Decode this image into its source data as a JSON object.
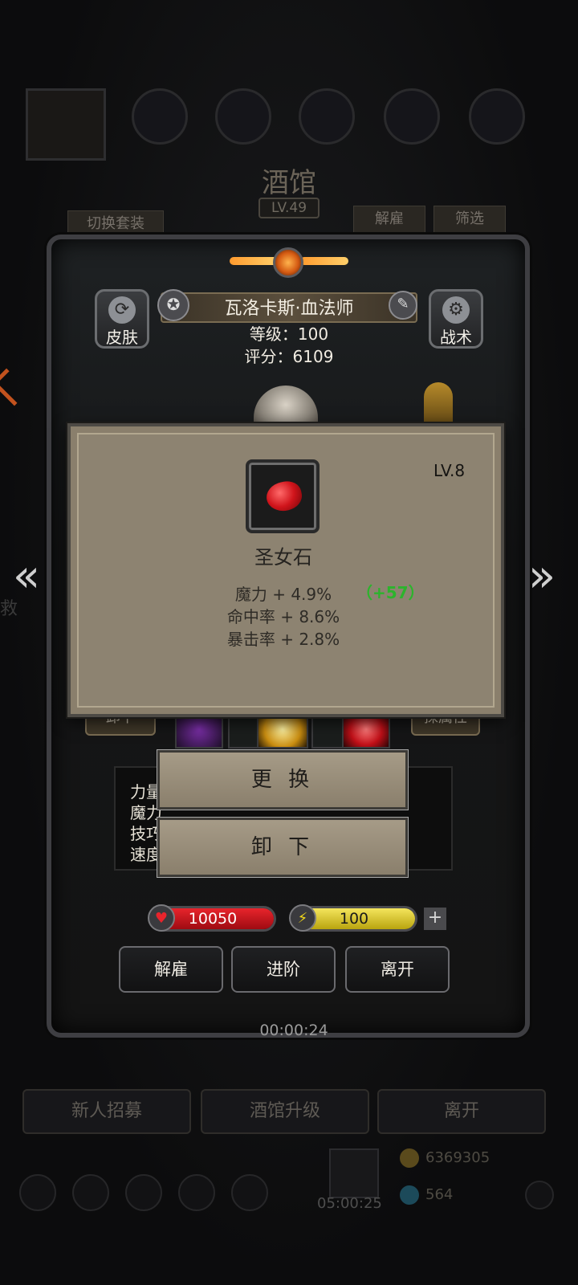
{
  "background": {
    "title": "酒馆",
    "level": "LV.49",
    "switch_outfit": "切换套装",
    "dismiss": "解雇",
    "filter": "筛选",
    "timer": "00:00:24",
    "bottom_buttons": [
      "新人招募",
      "酒馆升级",
      "离开"
    ],
    "gift_timer": "05:00:25",
    "gold": "6369305",
    "gems": "564",
    "side_text": "救"
  },
  "hero": {
    "skin_label": "皮肤",
    "tactics_label": "战术",
    "name": "瓦洛卡斯·血法师",
    "level_line": "等级：100",
    "score_line": "评分：6109",
    "unequip_tag": "卸下",
    "attr_tag": "探属性",
    "stats_labels": [
      "力量",
      "魔力",
      "技巧",
      "速度"
    ],
    "hp": "10050",
    "energy": "100",
    "plus": "+",
    "buttons": [
      "解雇",
      "进阶",
      "离开"
    ],
    "timer": "00:00:24"
  },
  "item_popup": {
    "level": "LV.8",
    "name": "圣女石",
    "stats": [
      "魔力 + 4.9%",
      "命中率 + 8.6%",
      "暴击率 + 2.8%"
    ],
    "bonus": "（+57）"
  },
  "actions": {
    "replace": "更 换",
    "unequip": "卸 下"
  },
  "nav": {
    "prev": "«",
    "next": "»"
  },
  "colors": {
    "popup_bg": "#8d8371",
    "bonus_green": "#2cb42c",
    "hp_red": "#c4101a",
    "energy_yellow": "#e2cf1b"
  }
}
